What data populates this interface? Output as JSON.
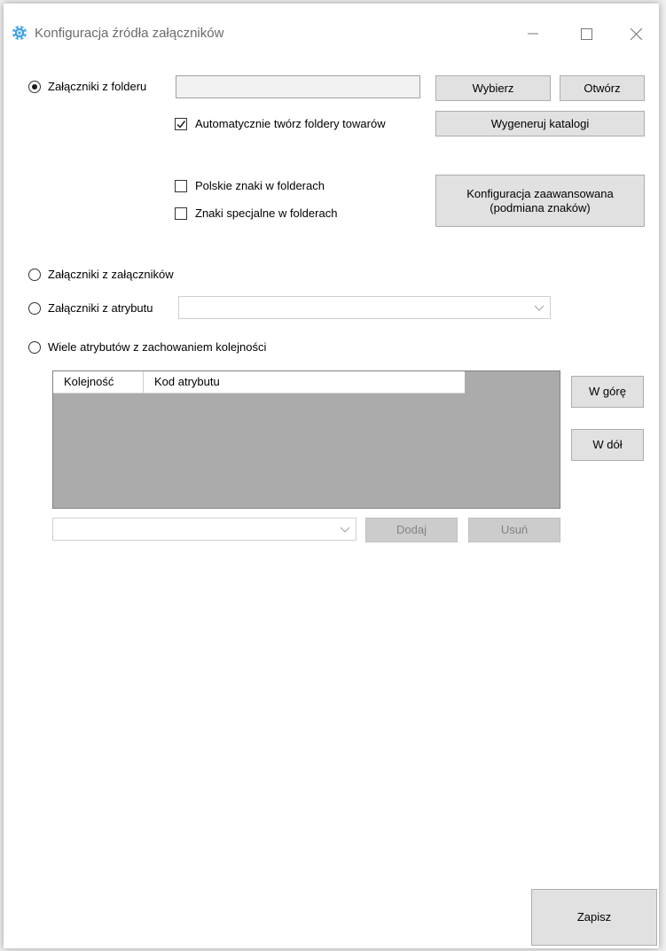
{
  "window": {
    "title": "Konfiguracja źródła załączników",
    "icon": "settings-gear-icon",
    "controls": {
      "minimize": "minimize-icon",
      "maximize": "maximize-icon",
      "close": "close-icon"
    }
  },
  "folder_source": {
    "radio_label": "Załączniki z folderu",
    "selected": true,
    "path_value": "",
    "choose_label": "Wybierz",
    "open_label": "Otwórz",
    "auto_create_label": "Automatycznie twórz foldery towarów",
    "auto_create_checked": true,
    "generate_label": "Wygeneruj katalogi",
    "polish_chars_label": "Polskie znaki w folderach",
    "polish_chars_checked": false,
    "special_chars_label": "Znaki specjalne w folderach",
    "special_chars_checked": false,
    "advanced_config_line1": "Konfiguracja zaawansowana",
    "advanced_config_line2": "(podmiana znaków)"
  },
  "attachments_source": {
    "radio_label": "Załączniki z załączników",
    "selected": false
  },
  "attribute_source": {
    "radio_label": "Załączniki z atrybutu",
    "selected": false,
    "value": ""
  },
  "multi_attribute_source": {
    "radio_label": "Wiele atrybutów z zachowaniem kolejności",
    "selected": false,
    "columns": [
      "Kolejność",
      "Kod atrybutu"
    ],
    "rows": [],
    "up_label": "W górę",
    "down_label": "W dół",
    "combo_value": "",
    "add_label": "Dodaj",
    "remove_label": "Usuń"
  },
  "footer": {
    "save_label": "Zapisz"
  },
  "colors": {
    "window_bg": "#ffffff",
    "button_bg": "#e1e1e1",
    "disabled_button_bg": "#cccccc",
    "grid_bg": "#ababab",
    "title_icon": "#3aa0e8"
  }
}
